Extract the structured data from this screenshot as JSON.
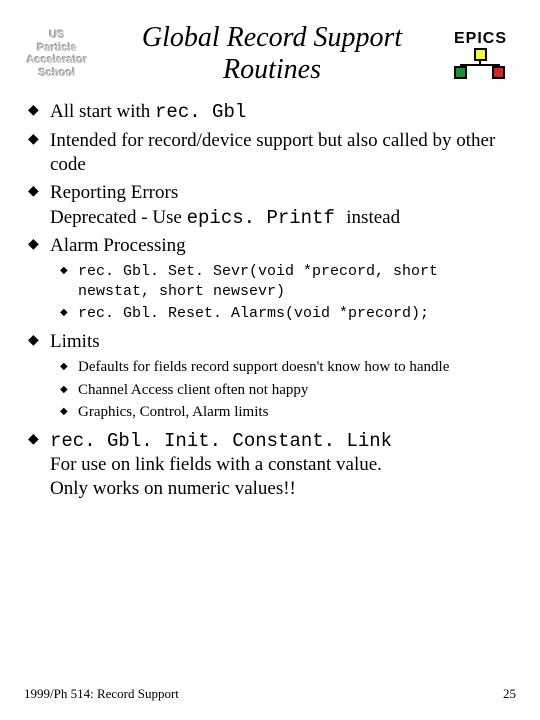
{
  "logo": {
    "l1": "US",
    "l2": "Particle",
    "l3": "Accelerator",
    "l4": "School"
  },
  "epics_label": "EPICS",
  "title": "Global Record Support Routines",
  "bullets": {
    "b1_pre": "All start with ",
    "b1_code": "rec. Gbl",
    "b2": "Intended for record/device support but also called by other code",
    "b3_l1": "Reporting Errors",
    "b3_l2_pre": "Deprecated - Use ",
    "b3_l2_code": "epics. Printf ",
    "b3_l2_post": "instead",
    "b4": "Alarm Processing",
    "b4_s1": "rec. Gbl. Set. Sevr(void *precord, short newstat, short newsevr)",
    "b4_s2": "rec. Gbl. Reset. Alarms(void *precord);",
    "b5": "Limits",
    "b5_s1": "Defaults for fields record support doesn't know how to handle",
    "b5_s2": "Channel Access client often not happy",
    "b5_s3": "Graphics, Control, Alarm limits",
    "b6_code": "rec. Gbl. Init. Constant. Link",
    "b6_l2": "For use on link fields with a constant value.",
    "b6_l3": "Only works on numeric values!!"
  },
  "footer": {
    "left": "1999/Ph 514: Record Support",
    "right": "25"
  }
}
